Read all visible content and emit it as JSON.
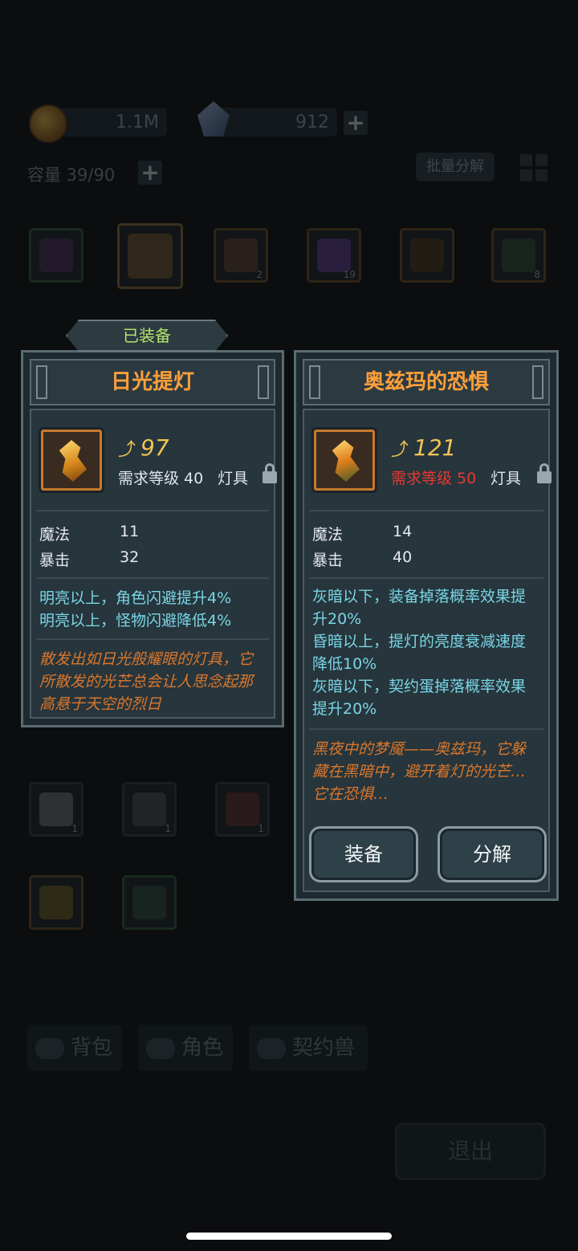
{
  "top": {
    "gold": "1.1M",
    "crystals": "912"
  },
  "capacity": "容量 39/90",
  "batch_decompose": "批量分解",
  "slots_row1_counts": [
    "",
    "",
    "2",
    "19",
    "",
    "8"
  ],
  "slots_row_lower_counts": [
    "1",
    "1",
    "1"
  ],
  "tabs": {
    "bag": "背包",
    "character": "角色",
    "pet": "契约兽"
  },
  "exit": "退出",
  "equipped_card": {
    "tag": "已装备",
    "name": "日光提灯",
    "power": "97",
    "requirement": "需求等级 40",
    "type": "灯具",
    "stats": [
      {
        "name": "魔法",
        "value": "11"
      },
      {
        "name": "暴击",
        "value": "32"
      }
    ],
    "effects": [
      "明亮以上，角色闪避提升4%",
      "明亮以上，怪物闪避降低4%"
    ],
    "lore": "散发出如日光般耀眼的灯具，它所散发的光芒总会让人思念起那高悬于天空的烈日"
  },
  "new_card": {
    "name": "奥兹玛的恐惧",
    "power": "121",
    "requirement": "需求等级 50",
    "type": "灯具",
    "stats": [
      {
        "name": "魔法",
        "value": "14"
      },
      {
        "name": "暴击",
        "value": "40"
      }
    ],
    "effects": "灰暗以下，装备掉落概率效果提升20%\n昏暗以上，提灯的亮度衰减速度降低10%\n灰暗以下，契约蛋掉落概率效果提升20%",
    "lore": "黑夜中的梦魇——奥兹玛，它躲藏在黑暗中，避开着灯的光芒…它在恐惧…",
    "equip_button": "装备",
    "decompose_button": "分解"
  },
  "colors": {
    "title_orange": "#ff9f3a",
    "effect_cyan": "#79d6e6",
    "lore_orange": "#d9772c",
    "req_red": "#e23a32",
    "equipped_green": "#b5e36b"
  }
}
